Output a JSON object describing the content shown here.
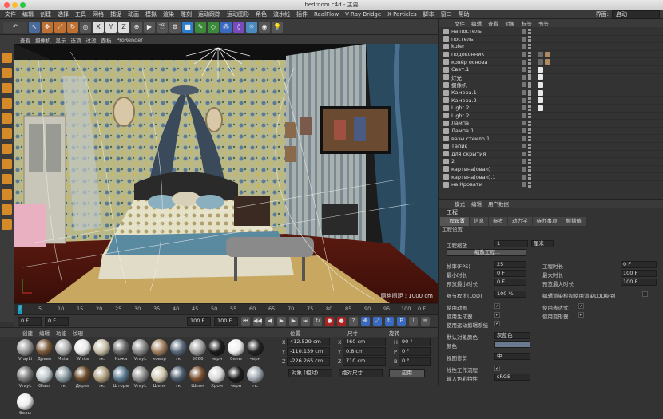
{
  "window": {
    "title": "bedroom.c4d - 主要"
  },
  "menubar": {
    "items": [
      "文件",
      "编辑",
      "创建",
      "选择",
      "工具",
      "网格",
      "捕捉",
      "动画",
      "模拟",
      "渲染",
      "雕刻",
      "运动跟踪",
      "运动图形",
      "角色",
      "流水线",
      "插件",
      "RealFlow",
      "V-Ray Bridge",
      "X-Particles",
      "脚本",
      "窗口",
      "帮助"
    ],
    "layout_label": "界面:",
    "layout_value": "启动"
  },
  "viewport": {
    "menu": [
      "查看",
      "摄像机",
      "显示",
      "选项",
      "过滤",
      "面板",
      "ProRender"
    ],
    "grid_spacing": "网格间距 : 1000 cm"
  },
  "timeline": {
    "ticks": [
      "0",
      "5",
      "10",
      "15",
      "20",
      "25",
      "30",
      "35",
      "40",
      "45",
      "50",
      "55",
      "60",
      "65",
      "70",
      "75",
      "80",
      "85",
      "90",
      "95",
      "100"
    ],
    "current_frame": "0 F"
  },
  "transport": {
    "start_field": "0 F",
    "current_field": "0 F",
    "end_field": "100 F",
    "end_field2": "100 F"
  },
  "materials": {
    "menu": [
      "创建",
      "编辑",
      "功能",
      "纹理"
    ],
    "items": [
      {
        "name": "VrayLi",
        "color": "#9a9a9a"
      },
      {
        "name": "Древе",
        "color": "#7a5a3a"
      },
      {
        "name": "Metal",
        "color": "#b0b0b0"
      },
      {
        "name": "White",
        "color": "#e8e8e8"
      },
      {
        "name": "тк.",
        "color": "#c8bfa8"
      },
      {
        "name": "Кожа",
        "color": "#6a6a6a"
      },
      {
        "name": "VrayL",
        "color": "#8a8a8a"
      },
      {
        "name": "ковер",
        "color": "#a08060"
      },
      {
        "name": "тк.",
        "color": "#5a6a7a"
      },
      {
        "name": "5666",
        "color": "#a0a0a0"
      },
      {
        "name": "черн",
        "color": "#1a1a1a"
      },
      {
        "name": "белы",
        "color": "#f0f0f0"
      },
      {
        "name": "черн",
        "color": "#222222"
      },
      {
        "name": "VrayL",
        "color": "#7a7a7a"
      },
      {
        "name": "Glass",
        "color": "#c0c8cc"
      },
      {
        "name": "тк.",
        "color": "#8a9aa0"
      },
      {
        "name": "Дерев",
        "color": "#6a4a2a"
      },
      {
        "name": "тк.",
        "color": "#b0a080"
      },
      {
        "name": "Шторы",
        "color": "#5a7a90"
      },
      {
        "name": "VrayL",
        "color": "#909090"
      },
      {
        "name": "Шелк",
        "color": "#d0c8b0"
      },
      {
        "name": "тк.",
        "color": "#4a5a6a"
      },
      {
        "name": "Шпон",
        "color": "#7a5030"
      },
      {
        "name": "Хром",
        "color": "#d8d8d8"
      },
      {
        "name": "черн",
        "color": "#1c1c1c"
      },
      {
        "name": "тк.",
        "color": "#a0a8b0"
      },
      {
        "name": "белы",
        "color": "#eeeeee"
      }
    ]
  },
  "coords": {
    "headers": [
      "位置",
      "尺寸",
      "旋转"
    ],
    "rows": [
      {
        "axis": "X",
        "pos": "412.529 cm",
        "size": "460 cm",
        "rot_axis": "H",
        "rot": "90 °"
      },
      {
        "axis": "Y",
        "pos": "-110.139 cm",
        "size": "0.8 cm",
        "rot_axis": "P",
        "rot": "0 °"
      },
      {
        "axis": "Z",
        "pos": "-226.265 cm",
        "size": "710 cm",
        "rot_axis": "B",
        "rot": "0 °"
      }
    ],
    "mode": "对象 (相对)",
    "size_mode": "绝对尺寸",
    "apply": "应用"
  },
  "objects": {
    "menu": [
      "文件",
      "编辑",
      "查看",
      "对象",
      "标签",
      "书签"
    ],
    "items": [
      "на постель",
      "постель",
      "kufer",
      "подоконник",
      "ковёр основа",
      "Свет.1",
      "灯光",
      "摄像机",
      "Камера.1",
      "Камера.2",
      "Light.2",
      "Light.2",
      "Лампа",
      "Лампа.1",
      "вазы стекло.1",
      "Тапик",
      "для скрытия",
      "2",
      "картина(овал)",
      "картина(овал).1",
      "на Кровати"
    ]
  },
  "attributes": {
    "menu": [
      "模式",
      "编辑",
      "用户数据"
    ],
    "title": "工程",
    "tabs": [
      "工程设置",
      "信息",
      "参考",
      "动力学",
      "待办事项",
      "帧插值"
    ],
    "section": "工程设置",
    "scale_label": "工程缩放",
    "scale_value": "1",
    "scale_unit": "厘米",
    "scale_button": "缩放工程...",
    "fps_label": "帧率(FPS)",
    "fps_value": "25",
    "proj_time_label": "工程时长",
    "proj_time_value": "0 F",
    "min_time_label": "最小时长",
    "min_time_value": "0 F",
    "max_time_label": "最大时长",
    "max_time_value": "100 F",
    "preview_min_label": "预览最小时长",
    "preview_min_value": "0 F",
    "preview_max_label": "预览最大时长",
    "preview_max_value": "100 F",
    "lod_label": "细节程度(LOD)",
    "lod_value": "100 %",
    "lod_render_label": "编辑渲染检视使用渲染LOD级别",
    "use_anim": "使用动画",
    "use_expr": "使用表达式",
    "use_gen": "使用生成器",
    "use_deform": "使用变形器",
    "use_motion": "使用运动剪辑系统",
    "default_color_label": "默认对象颜色",
    "default_color_value": "灰蓝色",
    "color_label": "颜色",
    "view_clip_label": "视图修剪",
    "view_clip_value": "中",
    "linear_label": "线性工作流程",
    "input_color_label": "输入色彩特性",
    "input_color_value": "sRGB"
  },
  "colors": {
    "accent": "#d58a2a",
    "timeline_playhead": "#17a0c4",
    "panel": "#333333"
  }
}
